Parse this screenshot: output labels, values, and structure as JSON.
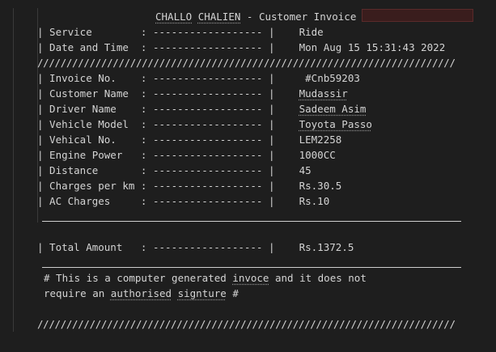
{
  "header": {
    "challo": "CHALLO",
    "chalien": "CHALIEN",
    "rest": " - Customer Invoice"
  },
  "top_rows": [
    {
      "label": "| Service        : ------------------ |    ",
      "value": "Ride"
    },
    {
      "label": "| Date and Time  : ------------------ |    ",
      "value": "Mon Aug 15 15:31:43 2022"
    }
  ],
  "separator": "////////////////////////////////////////////////////////////////////////",
  "rows": [
    {
      "label": "| Invoice No.    : ------------------ |     ",
      "value": "#Cnb59203"
    },
    {
      "label": "| Customer Name  : ------------------ |    ",
      "value": "Mudassir"
    },
    {
      "label": "| Driver Name    : ------------------ |    ",
      "value": "Sadeem Asim"
    },
    {
      "label": "| Vehicle Model  : ------------------ |    ",
      "value": "Toyota Passo"
    },
    {
      "label": "| Vehical No.    : ------------------ |    ",
      "value": "LEM2258"
    },
    {
      "label": "| Engine Power   : ------------------ |    ",
      "value": "1000CC"
    },
    {
      "label": "| Distance       : ------------------ |    ",
      "value": "45"
    },
    {
      "label": "| Charges per km : ------------------ |    ",
      "value": "Rs.30.5"
    },
    {
      "label": "| AC Charges     : ------------------ |    ",
      "value": "Rs.10"
    }
  ],
  "total": {
    "label": "| Total Amount   : ------------------ |    ",
    "value": "Rs.1372.5"
  },
  "footer": {
    "line1": "# This is a computer generated invoce and it does not",
    "line2": "require an authorised signture #"
  },
  "colors": {
    "background": "#1e1e1e",
    "text": "#d4d4d4",
    "find_highlight": "#3a1d1d"
  }
}
